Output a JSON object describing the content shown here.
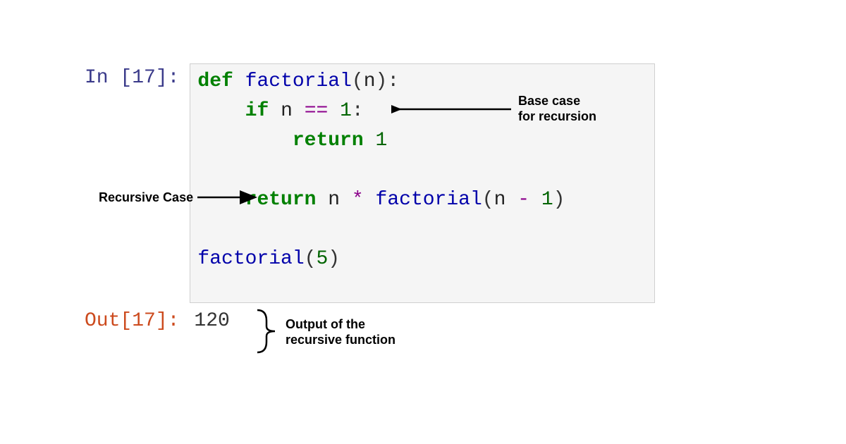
{
  "notebook": {
    "in_prompt": "In [17]:",
    "out_prompt": "Out[17]:",
    "code": {
      "line1": {
        "def": "def",
        "fn": "factorial",
        "open": "(",
        "arg": "n",
        "close": "):"
      },
      "line2": {
        "indent": "    ",
        "if": "if",
        "var": "n",
        "eq": "==",
        "num": "1",
        "colon": ":"
      },
      "line3": {
        "indent": "        ",
        "return": "return",
        "num": "1"
      },
      "line4": "",
      "line5": {
        "indent": "    ",
        "return": "return",
        "var": "n",
        "mul": "*",
        "fn": "factorial",
        "open": "(",
        "arg": "n",
        "minus": "-",
        "one": "1",
        "close": ")"
      },
      "line6": "",
      "line7": {
        "fn": "factorial",
        "open": "(",
        "arg": "5",
        "close": ")"
      }
    },
    "output_value": "120"
  },
  "annotations": {
    "base_case": {
      "line1": "Base case",
      "line2": "for recursion"
    },
    "recursive_case": "Recursive Case",
    "output_label": {
      "line1": "Output of the",
      "line2": "recursive function"
    }
  },
  "cell_number": 17
}
